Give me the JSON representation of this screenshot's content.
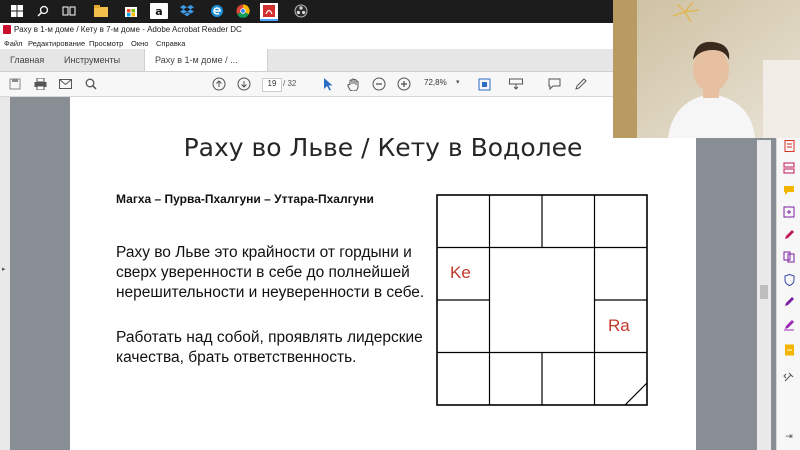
{
  "window": {
    "title": "Раху в 1-м доме / Кету в 7-м доме - Adobe Acrobat Reader DC"
  },
  "menu": [
    "Файл",
    "Редактирование",
    "Просмотр",
    "Окно",
    "Справка"
  ],
  "tabs": {
    "home": "Главная",
    "tools": "Инструменты",
    "document": "Раху в 1-м доме / ..."
  },
  "toolbar": {
    "page_current": "19",
    "page_total": "/ 32",
    "zoom": "72,8%"
  },
  "slide": {
    "title": "Раху во Льве / Кету в Водолее",
    "subtitle": "Магха – Пурва-Пхалгуни – Уттара-Пхалгуни",
    "paragraph1": "Раху во Льве это крайности от гордыни и сверх уверенности в себе до полнейшей нерешительности и неуверенности в себе.",
    "paragraph2": "Работать над собой, проявлять лидерские качества, брать ответственность."
  },
  "chart": {
    "label_ke": "Ke",
    "label_ra": "Ra",
    "label_color": "#c0392b"
  },
  "icons": {
    "taskbar": [
      "windows-icon",
      "search-icon",
      "task-view-icon",
      "file-explorer-icon",
      "store-icon",
      "amazon-icon",
      "dropbox-icon",
      "edge-icon",
      "chrome-icon",
      "acrobat-icon",
      "obs-icon"
    ]
  }
}
